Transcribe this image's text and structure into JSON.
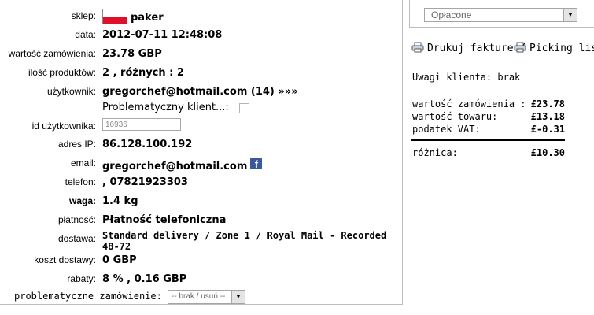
{
  "order": {
    "shop": {
      "label": "sklep:",
      "value": "paker"
    },
    "date": {
      "label": "data:",
      "value": "2012-07-11 12:48:08"
    },
    "order_value": {
      "label": "wartość zamówienia:",
      "value": "23.78 GBP"
    },
    "product_count": {
      "label": "ilość produktów:",
      "value": "2 , różnych : 2"
    },
    "user": {
      "label": "użytkownik:",
      "value": "gregorchef@hotmail.com (14) »»»"
    },
    "problematic_client": {
      "label": "Problematyczny klient...:",
      "checked": false
    },
    "user_id": {
      "label": "id użytkownika:",
      "value": "16936"
    },
    "ip": {
      "label": "adres IP:",
      "value": "86.128.100.192"
    },
    "email": {
      "label": "email:",
      "value": "gregorchef@hotmail.com",
      "icon": "facebook-icon"
    },
    "phone": {
      "label": "telefon:",
      "value": ", 07821923303"
    },
    "weight": {
      "label": "waga:",
      "value": "1.4 kg"
    },
    "payment": {
      "label": "płatność:",
      "value": "Płatność telefoniczna"
    },
    "delivery": {
      "label": "dostawa:",
      "value_line1": "Standard delivery / Zone 1 / Royal Mail - Recorded",
      "value_line2": "48-72"
    },
    "delivery_cost": {
      "label": "koszt dostawy:",
      "value": "0 GBP"
    },
    "discounts": {
      "label": "rabaty:",
      "value": "8 % , 0.16 GBP"
    },
    "problematic_order": {
      "label": "problematyczne zamówienie:",
      "selected": "-- brak / usuń --"
    }
  },
  "side": {
    "status_select": {
      "selected": "Opłacone"
    },
    "print_invoice": "Drukuj fakture /",
    "picking_list": "Picking list /",
    "client_notes": "Uwagi klienta: brak",
    "summary": {
      "order_value": {
        "label": "wartość zamówienia :",
        "value": "£23.78"
      },
      "goods_value": {
        "label": "wartość towaru:",
        "value": "£13.18"
      },
      "vat": {
        "label": "podatek VAT:",
        "value": "£-0.31"
      },
      "difference": {
        "label": "różnica:",
        "value": "£10.30"
      }
    }
  },
  "colors": {
    "facebook": "#3b5998",
    "flag_red": "#e0102a",
    "border": "#bdbdbd"
  }
}
